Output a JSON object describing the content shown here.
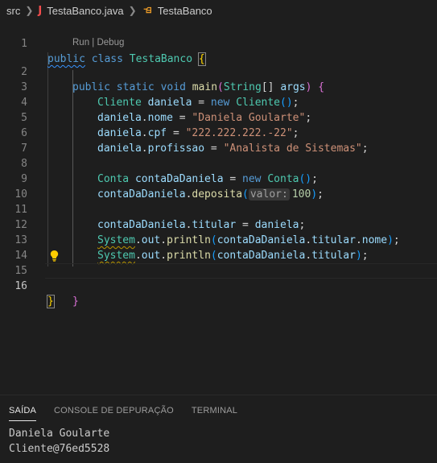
{
  "breadcrumb": {
    "folder": "src",
    "file": "TestaBanco.java",
    "symbol": "TestaBanco",
    "file_icon": "java-icon",
    "symbol_icon": "class-icon"
  },
  "editor": {
    "codelens": "Run | Debug",
    "line_numbers": [
      "1",
      "2",
      "3",
      "4",
      "5",
      "6",
      "7",
      "8",
      "9",
      "10",
      "11",
      "12",
      "13",
      "14",
      "15",
      "16"
    ],
    "tokens": {
      "l1_public": "public",
      "l1_class": "class",
      "l1_name": "TestaBanco",
      "l1_brace": "{",
      "l2_public": "public",
      "l2_static": "static",
      "l2_void": "void",
      "l2_main": "main",
      "l2_paren_open": "(",
      "l2_string": "String",
      "l2_arr": "[]",
      "l2_args": "args",
      "l2_paren_close": ")",
      "l2_brace": "{",
      "l3_type": "Cliente",
      "l3_var": "daniela",
      "l3_eq": "=",
      "l3_new": "new",
      "l3_ctor": "Cliente",
      "l3_parens": "()",
      "l3_semi": ";",
      "l4_obj": "daniela",
      "l4_field": "nome",
      "l4_eq": "=",
      "l4_val": "\"Daniela Goularte\"",
      "l4_semi": ";",
      "l5_obj": "daniela",
      "l5_field": "cpf",
      "l5_eq": "=",
      "l5_val": "\"222.222.222.-22\"",
      "l5_semi": ";",
      "l6_obj": "daniela",
      "l6_field": "profissao",
      "l6_eq": "=",
      "l6_val": "\"Analista de Sistemas\"",
      "l6_semi": ";",
      "l8_type": "Conta",
      "l8_var": "contaDaDaniela",
      "l8_eq": "=",
      "l8_new": "new",
      "l8_ctor": "Conta",
      "l8_parens": "()",
      "l8_semi": ";",
      "l9_obj": "contaDaDaniela",
      "l9_method": "deposita",
      "l9_paren_open": "(",
      "l9_hint": "valor:",
      "l9_num": "100",
      "l9_paren_close": ")",
      "l9_semi": ";",
      "l11_obj": "contaDaDaniela",
      "l11_field": "titular",
      "l11_eq": "=",
      "l11_val": "daniela",
      "l11_semi": ";",
      "l12_sys": "System",
      "l12_out": "out",
      "l12_println": "println",
      "l12_paren_open": "(",
      "l12_obj": "contaDaDaniela",
      "l12_f1": "titular",
      "l12_f2": "nome",
      "l12_paren_close": ")",
      "l12_semi": ";",
      "l13_sys": "System",
      "l13_out": "out",
      "l13_println": "println",
      "l13_paren_open": "(",
      "l13_obj": "contaDaDaniela",
      "l13_f1": "titular",
      "l13_paren_close": ")",
      "l13_semi": ";",
      "l15_brace": "}",
      "l16_brace": "}"
    }
  },
  "panel": {
    "tabs": [
      "SAÍDA",
      "CONSOLE DE DEPURAÇÃO",
      "TERMINAL"
    ],
    "active_tab": "SAÍDA",
    "output_lines": [
      "Daniela Goularte",
      "Cliente@76ed5528"
    ]
  },
  "colors": {
    "background": "#1e1e1e",
    "keyword": "#569cd6",
    "type": "#4ec9b0",
    "function": "#dcdcaa",
    "variable": "#9cdcfe",
    "string": "#ce9178",
    "number": "#b5cea8",
    "error_icon": "#f14c4c"
  }
}
